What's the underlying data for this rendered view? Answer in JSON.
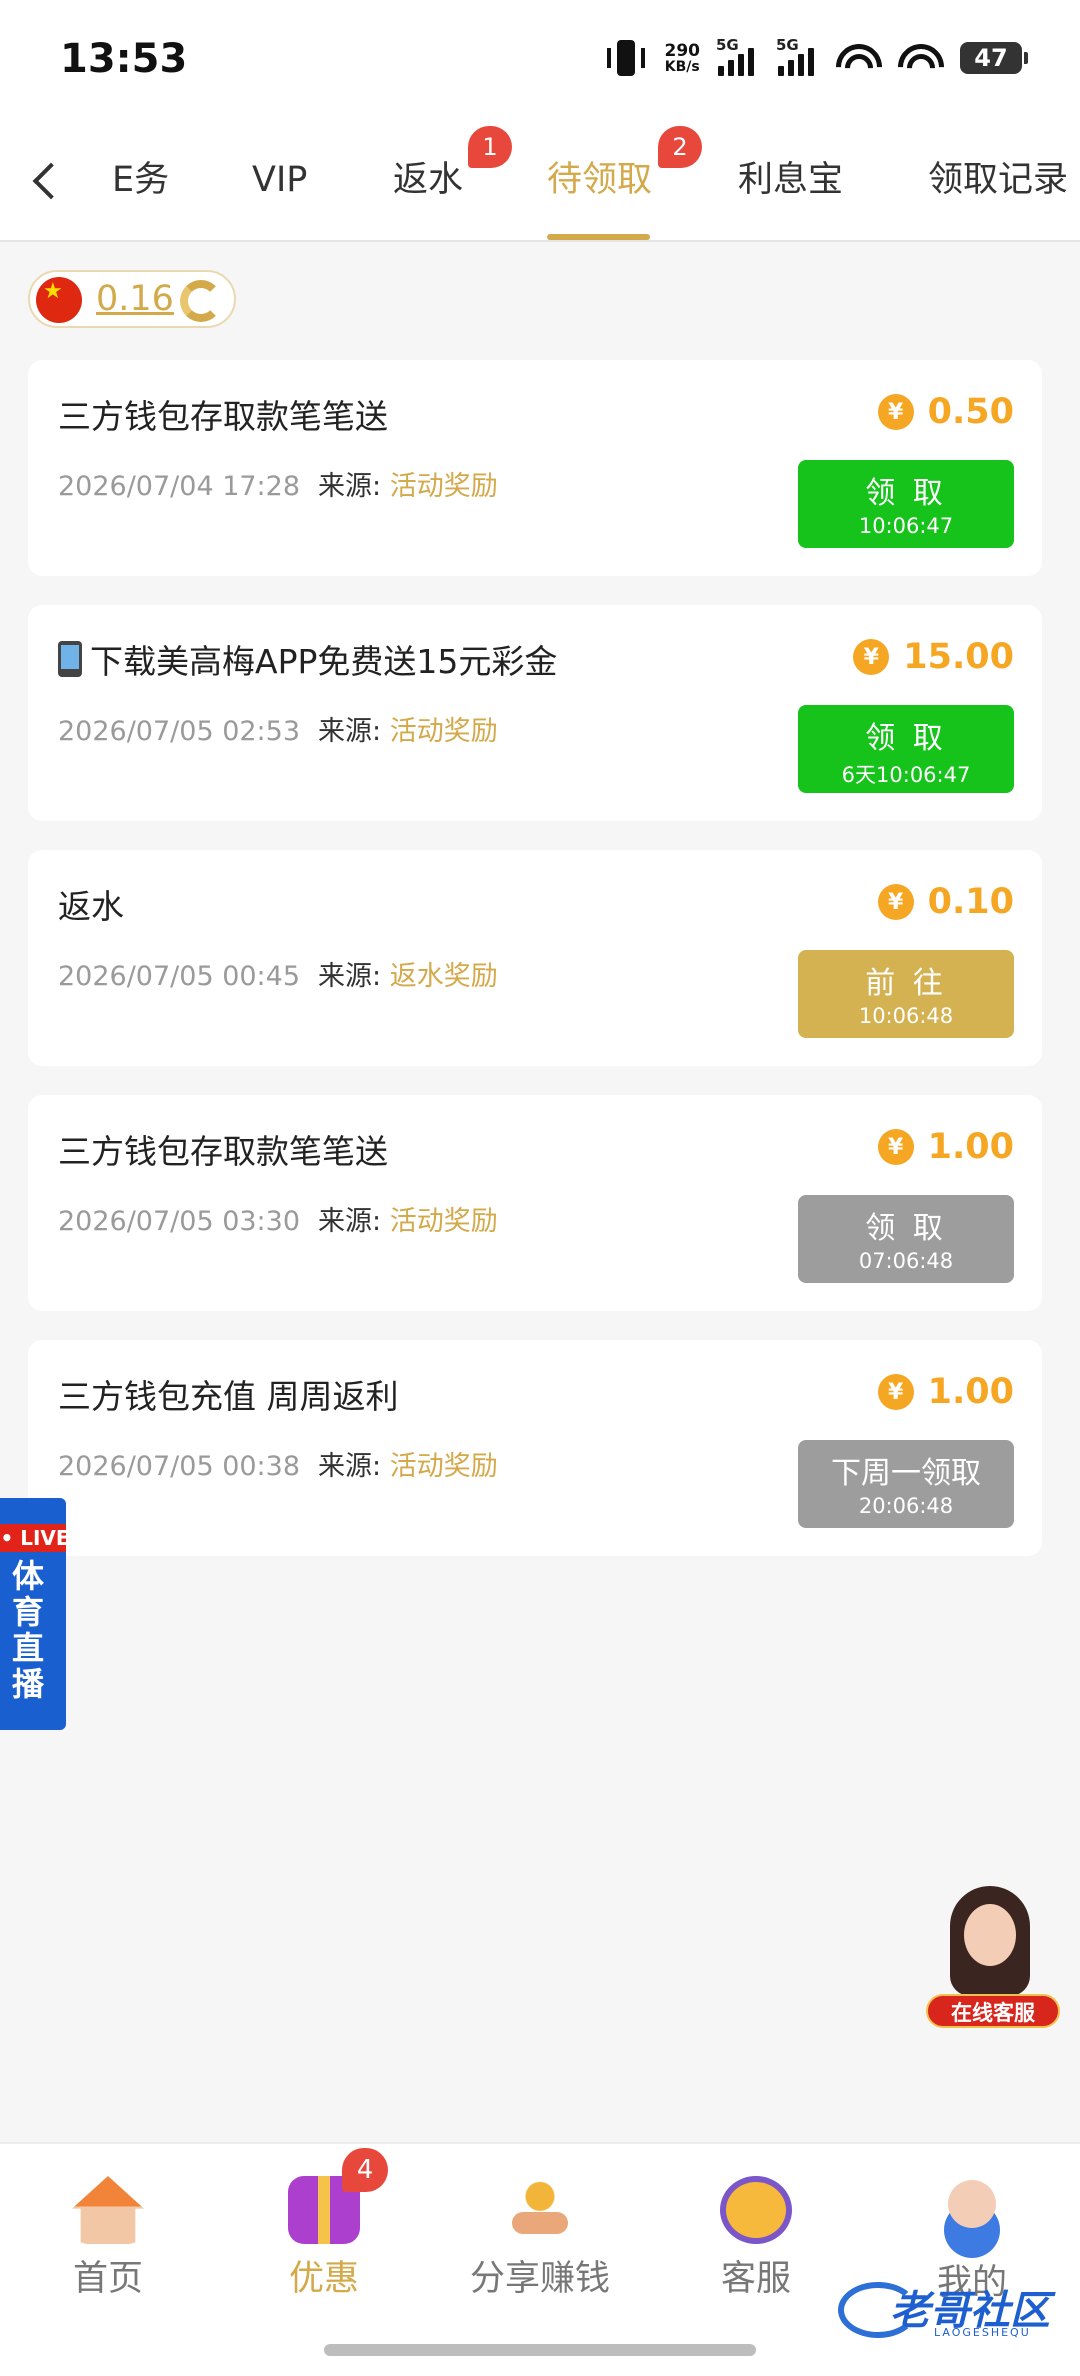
{
  "status_bar": {
    "time": "13:53",
    "net_speed_value": "290",
    "net_speed_unit": "KB/s",
    "sim1": "5G",
    "sim2": "5G",
    "battery": "47"
  },
  "tabs": [
    {
      "label": "E务",
      "active": false
    },
    {
      "label": "VIP",
      "active": false
    },
    {
      "label": "返水",
      "active": false,
      "badge": "1"
    },
    {
      "label": "待领取",
      "active": true,
      "badge": "2"
    },
    {
      "label": "利息宝",
      "active": false
    },
    {
      "label": "领取记录",
      "active": false
    }
  ],
  "balance": {
    "value": "0.16"
  },
  "source_label": "来源:",
  "rewards": [
    {
      "title": "三方钱包存取款笔笔送",
      "date": "2026/07/04 17:28",
      "source": "活动奖励",
      "amount": "0.50",
      "button": "领 取",
      "timer": "10:06:47",
      "button_color": "#15c31a"
    },
    {
      "title": "下载美高梅APP免费送15元彩金",
      "date": "2026/07/05 02:53",
      "source": "活动奖励",
      "amount": "15.00",
      "button": "领 取",
      "timer": "6天10:06:47",
      "button_color": "#15c31a"
    },
    {
      "title": "返水",
      "date": "2026/07/05 00:45",
      "source": "返水奖励",
      "amount": "0.10",
      "button": "前 往",
      "timer": "10:06:48",
      "button_color": "#d4b151"
    },
    {
      "title": "三方钱包存取款笔笔送",
      "date": "2026/07/05 03:30",
      "source": "活动奖励",
      "amount": "1.00",
      "button": "领 取",
      "timer": "07:06:48",
      "button_color": "#9d9d9d"
    },
    {
      "title": "三方钱包充值 周周返利",
      "date": "2026/07/05 00:38",
      "source": "活动奖励",
      "amount": "1.00",
      "button": "下周一领取",
      "timer": "20:06:48",
      "button_color": "#9d9d9d"
    }
  ],
  "live_banner": {
    "tag": "• LIVE",
    "text": "体育直播"
  },
  "service_float": {
    "label": "在线客服"
  },
  "bottom_nav": [
    {
      "label": "首页",
      "icon": "home-icon"
    },
    {
      "label": "优惠",
      "icon": "gift-icon",
      "active": true,
      "badge": "4"
    },
    {
      "label": "分享赚钱",
      "icon": "handshake-icon"
    },
    {
      "label": "客服",
      "icon": "headset-icon"
    },
    {
      "label": "我的",
      "icon": "user-icon"
    }
  ],
  "watermark": {
    "text": "老哥社区",
    "sub": "LAOGESHEQU"
  },
  "colors": {
    "accent": "#d3a94a",
    "coin": "#f5a623",
    "green": "#15c31a",
    "gray_button": "#9d9d9d",
    "badge": "#e8473b"
  }
}
